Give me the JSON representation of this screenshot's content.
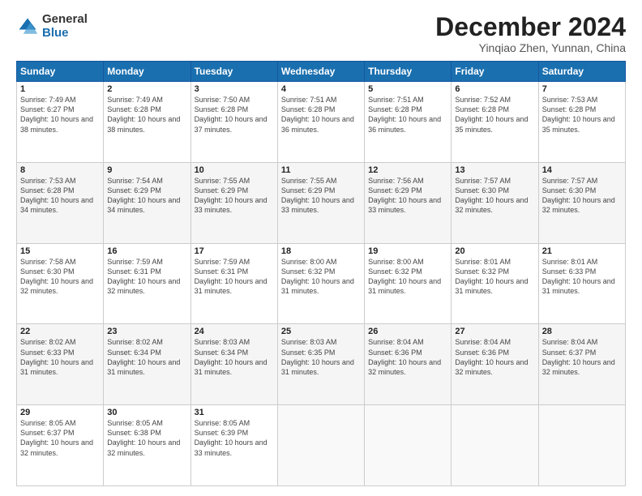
{
  "logo": {
    "general": "General",
    "blue": "Blue"
  },
  "title": "December 2024",
  "location": "Yinqiao Zhen, Yunnan, China",
  "days_of_week": [
    "Sunday",
    "Monday",
    "Tuesday",
    "Wednesday",
    "Thursday",
    "Friday",
    "Saturday"
  ],
  "weeks": [
    [
      {
        "day": "1",
        "sunrise": "7:49 AM",
        "sunset": "6:27 PM",
        "daylight": "10 hours and 38 minutes"
      },
      {
        "day": "2",
        "sunrise": "7:49 AM",
        "sunset": "6:28 PM",
        "daylight": "10 hours and 38 minutes"
      },
      {
        "day": "3",
        "sunrise": "7:50 AM",
        "sunset": "6:28 PM",
        "daylight": "10 hours and 37 minutes"
      },
      {
        "day": "4",
        "sunrise": "7:51 AM",
        "sunset": "6:28 PM",
        "daylight": "10 hours and 36 minutes"
      },
      {
        "day": "5",
        "sunrise": "7:51 AM",
        "sunset": "6:28 PM",
        "daylight": "10 hours and 36 minutes"
      },
      {
        "day": "6",
        "sunrise": "7:52 AM",
        "sunset": "6:28 PM",
        "daylight": "10 hours and 35 minutes"
      },
      {
        "day": "7",
        "sunrise": "7:53 AM",
        "sunset": "6:28 PM",
        "daylight": "10 hours and 35 minutes"
      }
    ],
    [
      {
        "day": "8",
        "sunrise": "7:53 AM",
        "sunset": "6:28 PM",
        "daylight": "10 hours and 34 minutes"
      },
      {
        "day": "9",
        "sunrise": "7:54 AM",
        "sunset": "6:29 PM",
        "daylight": "10 hours and 34 minutes"
      },
      {
        "day": "10",
        "sunrise": "7:55 AM",
        "sunset": "6:29 PM",
        "daylight": "10 hours and 33 minutes"
      },
      {
        "day": "11",
        "sunrise": "7:55 AM",
        "sunset": "6:29 PM",
        "daylight": "10 hours and 33 minutes"
      },
      {
        "day": "12",
        "sunrise": "7:56 AM",
        "sunset": "6:29 PM",
        "daylight": "10 hours and 33 minutes"
      },
      {
        "day": "13",
        "sunrise": "7:57 AM",
        "sunset": "6:30 PM",
        "daylight": "10 hours and 32 minutes"
      },
      {
        "day": "14",
        "sunrise": "7:57 AM",
        "sunset": "6:30 PM",
        "daylight": "10 hours and 32 minutes"
      }
    ],
    [
      {
        "day": "15",
        "sunrise": "7:58 AM",
        "sunset": "6:30 PM",
        "daylight": "10 hours and 32 minutes"
      },
      {
        "day": "16",
        "sunrise": "7:59 AM",
        "sunset": "6:31 PM",
        "daylight": "10 hours and 32 minutes"
      },
      {
        "day": "17",
        "sunrise": "7:59 AM",
        "sunset": "6:31 PM",
        "daylight": "10 hours and 31 minutes"
      },
      {
        "day": "18",
        "sunrise": "8:00 AM",
        "sunset": "6:32 PM",
        "daylight": "10 hours and 31 minutes"
      },
      {
        "day": "19",
        "sunrise": "8:00 AM",
        "sunset": "6:32 PM",
        "daylight": "10 hours and 31 minutes"
      },
      {
        "day": "20",
        "sunrise": "8:01 AM",
        "sunset": "6:32 PM",
        "daylight": "10 hours and 31 minutes"
      },
      {
        "day": "21",
        "sunrise": "8:01 AM",
        "sunset": "6:33 PM",
        "daylight": "10 hours and 31 minutes"
      }
    ],
    [
      {
        "day": "22",
        "sunrise": "8:02 AM",
        "sunset": "6:33 PM",
        "daylight": "10 hours and 31 minutes"
      },
      {
        "day": "23",
        "sunrise": "8:02 AM",
        "sunset": "6:34 PM",
        "daylight": "10 hours and 31 minutes"
      },
      {
        "day": "24",
        "sunrise": "8:03 AM",
        "sunset": "6:34 PM",
        "daylight": "10 hours and 31 minutes"
      },
      {
        "day": "25",
        "sunrise": "8:03 AM",
        "sunset": "6:35 PM",
        "daylight": "10 hours and 31 minutes"
      },
      {
        "day": "26",
        "sunrise": "8:04 AM",
        "sunset": "6:36 PM",
        "daylight": "10 hours and 32 minutes"
      },
      {
        "day": "27",
        "sunrise": "8:04 AM",
        "sunset": "6:36 PM",
        "daylight": "10 hours and 32 minutes"
      },
      {
        "day": "28",
        "sunrise": "8:04 AM",
        "sunset": "6:37 PM",
        "daylight": "10 hours and 32 minutes"
      }
    ],
    [
      {
        "day": "29",
        "sunrise": "8:05 AM",
        "sunset": "6:37 PM",
        "daylight": "10 hours and 32 minutes"
      },
      {
        "day": "30",
        "sunrise": "8:05 AM",
        "sunset": "6:38 PM",
        "daylight": "10 hours and 32 minutes"
      },
      {
        "day": "31",
        "sunrise": "8:05 AM",
        "sunset": "6:39 PM",
        "daylight": "10 hours and 33 minutes"
      },
      null,
      null,
      null,
      null
    ]
  ]
}
